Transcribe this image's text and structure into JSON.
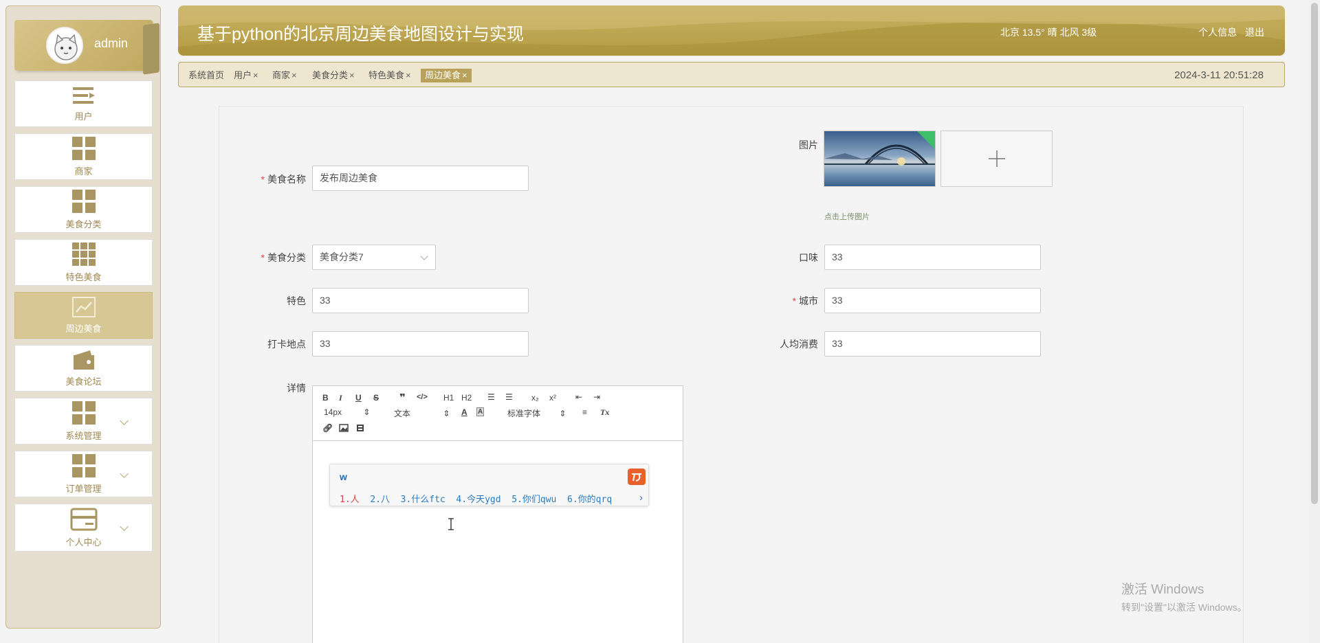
{
  "sidebar": {
    "user": {
      "name": "admin"
    },
    "items": [
      {
        "label": "用户",
        "icon": "user-list-icon"
      },
      {
        "label": "商家",
        "icon": "grid-icon"
      },
      {
        "label": "美食分类",
        "icon": "grid-icon"
      },
      {
        "label": "特色美食",
        "icon": "grid-nine-icon"
      },
      {
        "label": "周边美食",
        "icon": "chart-line-icon",
        "active": true
      },
      {
        "label": "美食论坛",
        "icon": "wallet-icon"
      },
      {
        "label": "系统管理",
        "icon": "grid-icon",
        "expandable": true
      },
      {
        "label": "订单管理",
        "icon": "grid-icon",
        "expandable": true
      },
      {
        "label": "个人中心",
        "icon": "card-icon",
        "expandable": true
      }
    ]
  },
  "header": {
    "title": "基于python的北京周边美食地图设计与实现",
    "weather": "北京  13.5°  晴  北风  3级",
    "profile_link": "个人信息",
    "logout_link": "退出"
  },
  "tabs": {
    "items": [
      {
        "label": "系统首页",
        "closable": false
      },
      {
        "label": "用户",
        "closable": true
      },
      {
        "label": "商家",
        "closable": true
      },
      {
        "label": "美食分类",
        "closable": true
      },
      {
        "label": "特色美食",
        "closable": true
      },
      {
        "label": "周边美食",
        "closable": true,
        "active": true
      }
    ],
    "close_glyph": "×",
    "datetime": "2024-3-11 20:51:28"
  },
  "form": {
    "name_label": "美食名称",
    "name_value": "发布周边美食",
    "image_label": "图片",
    "upload_tip": "点击上传图片",
    "category_label": "美食分类",
    "category_value": "美食分类7",
    "taste_label": "口味",
    "taste_value": "33",
    "feature_label": "特色",
    "feature_value": "33",
    "city_label": "城市",
    "city_value": "33",
    "checkin_label": "打卡地点",
    "checkin_value": "33",
    "avg_cost_label": "人均消费",
    "avg_cost_value": "33",
    "detail_label": "详情",
    "required_mark": "*"
  },
  "editor": {
    "font_size": "14px",
    "text_type": "文本",
    "font_family": "标准字体",
    "h1": "H1",
    "h2": "H2",
    "ime": {
      "input": "w",
      "c1": "1.人",
      "c2": "2.八",
      "c3": "3.什么ftc",
      "c4": "4.今天ygd",
      "c5": "5.你们qwu",
      "c6": "6.你的qrq"
    }
  },
  "watermark": {
    "line1": "激活 Windows",
    "line2": "转到\"设置\"以激活 Windows。"
  },
  "colors": {
    "accent": "#b8a158",
    "header_gold": "#c6b263",
    "required": "#e84040"
  }
}
